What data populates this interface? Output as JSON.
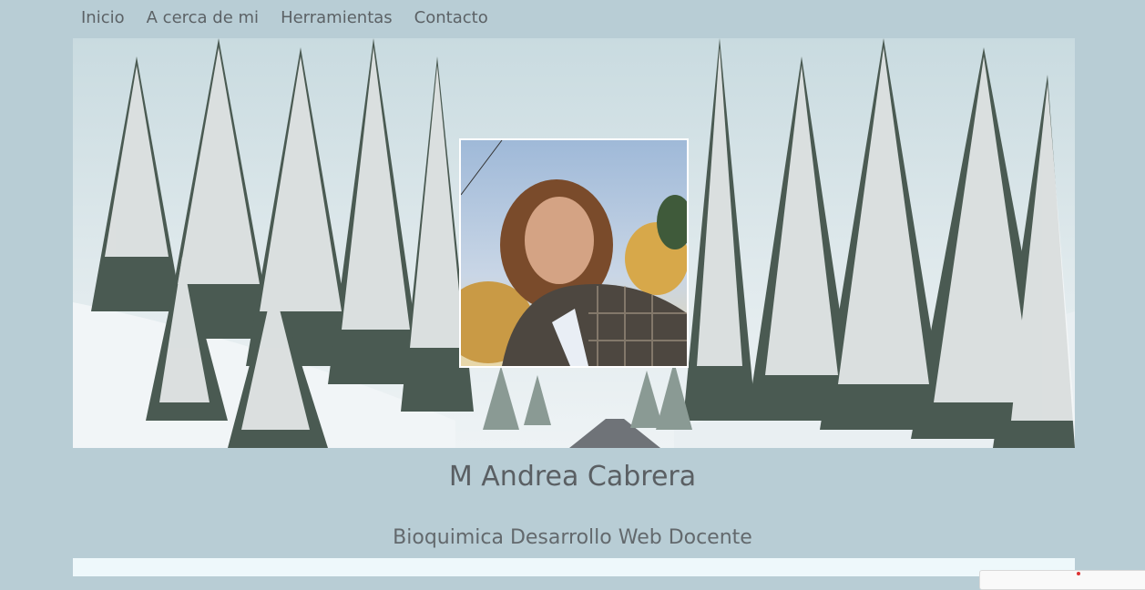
{
  "nav": {
    "items": [
      "Inicio",
      "A cerca de mi",
      "Herramientas",
      "Contacto"
    ]
  },
  "hero": {
    "image": "snowy-pine-forest-road",
    "portrait": "profile-photo"
  },
  "profile": {
    "name": "M Andrea Cabrera",
    "subtitle": "Bioquimica Desarrollo Web Docente"
  },
  "colors": {
    "page_background": "#b8cdd5",
    "text": "#5e6468",
    "panel": "#eef8fb"
  }
}
